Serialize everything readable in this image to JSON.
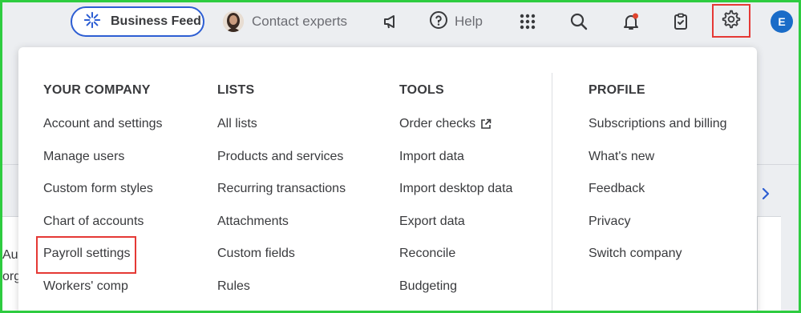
{
  "topbar": {
    "business_feed_label": "Business Feed",
    "contact_label": "Contact experts",
    "help_label": "Help",
    "user_initial": "E"
  },
  "background": {
    "left_text_1": "Au",
    "left_text_2": "org"
  },
  "menu": {
    "columns": [
      {
        "heading": "YOUR COMPANY",
        "items": [
          "Account and settings",
          "Manage users",
          "Custom form styles",
          "Chart of accounts",
          "Payroll settings",
          "Workers' comp"
        ]
      },
      {
        "heading": "LISTS",
        "items": [
          "All lists",
          "Products and services",
          "Recurring transactions",
          "Attachments",
          "Custom fields",
          "Rules"
        ]
      },
      {
        "heading": "TOOLS",
        "items": [
          "Order checks",
          "Import data",
          "Import desktop data",
          "Export data",
          "Reconcile",
          "Budgeting"
        ]
      },
      {
        "heading": "PROFILE",
        "items": [
          "Subscriptions and billing",
          "What's new",
          "Feedback",
          "Privacy",
          "Switch company"
        ]
      }
    ]
  },
  "icons": {
    "business_feed": "sparkle-icon",
    "megaphone": "megaphone-icon",
    "help": "question-circle-icon",
    "apps": "grid-icon",
    "search": "search-icon",
    "notifications": "bell-icon",
    "tasks": "clipboard-check-icon",
    "settings": "gear-icon",
    "external": "external-link-icon"
  },
  "colors": {
    "accent_blue": "#2d5ed3",
    "highlight_red": "#e53935",
    "frame_green": "#2ecc40",
    "notification_dot": "#e0442e"
  }
}
